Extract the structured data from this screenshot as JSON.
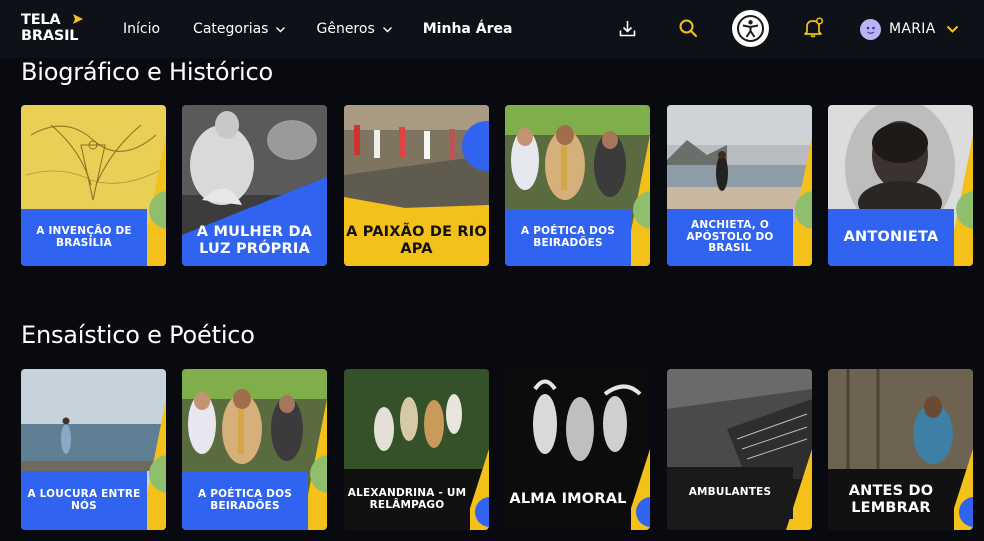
{
  "brand": {
    "line1": "TELA",
    "line2": "BRASIL"
  },
  "nav": {
    "inicio": "Início",
    "categorias": "Categorias",
    "generos": "Gêneros",
    "minha_area": "Minha Área"
  },
  "user": {
    "name": "MARIA"
  },
  "colors": {
    "accent_yellow": "#f3c11a",
    "card_blue": "#2f63f0",
    "card_green": "#8fbe6c",
    "topbar_bg": "#0e1118",
    "page_bg": "#080a10"
  },
  "sections": [
    {
      "title": "Biográfico e Histórico",
      "cards": [
        {
          "title": "A INVENÇÃO DE BRASÍLIA"
        },
        {
          "title": "A MULHER DA LUZ PRÓPRIA"
        },
        {
          "title": "A PAIXÃO DE RIO APA"
        },
        {
          "title": "A POÉTICA DOS BEIRADÕES"
        },
        {
          "title": "ANCHIETA, O APÓSTOLO DO BRASIL"
        },
        {
          "title": "ANTONIETA"
        }
      ]
    },
    {
      "title": "Ensaístico e Poético",
      "cards": [
        {
          "title": "A LOUCURA ENTRE NÓS"
        },
        {
          "title": "A POÉTICA DOS BEIRADÕES"
        },
        {
          "title": "ALEXANDRINA - UM RELÂMPAGO"
        },
        {
          "title": "ALMA IMORAL"
        },
        {
          "title": "AMBULANTES"
        },
        {
          "title": "ANTES DO LEMBRAR"
        }
      ]
    }
  ]
}
